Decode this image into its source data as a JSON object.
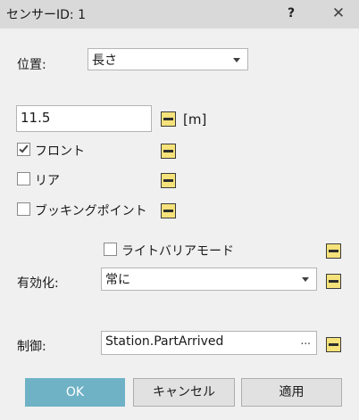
{
  "window": {
    "title": "センサーID: 1",
    "help_label": "?",
    "close_label": "✕"
  },
  "position": {
    "label": "位置:",
    "selected": "長さ"
  },
  "length": {
    "value": "11.5",
    "unit": "[m]"
  },
  "checkboxes": [
    {
      "label": "フロント",
      "checked": true
    },
    {
      "label": "リア",
      "checked": false
    },
    {
      "label": "ブッキングポイント",
      "checked": false
    }
  ],
  "light_barrier": {
    "label": "ライトバリアモード",
    "checked": false
  },
  "enable": {
    "label": "有効化:",
    "selected": "常に"
  },
  "control": {
    "label": "制御:",
    "value": "Station.PartArrived",
    "browse_label": "..."
  },
  "buttons": {
    "ok": "OK",
    "cancel": "キャンセル",
    "apply": "適用"
  },
  "colors": {
    "ok_button": "#6fb2c6",
    "binding_button": "#f6e27a",
    "titlebar": "#d9d9d9"
  }
}
